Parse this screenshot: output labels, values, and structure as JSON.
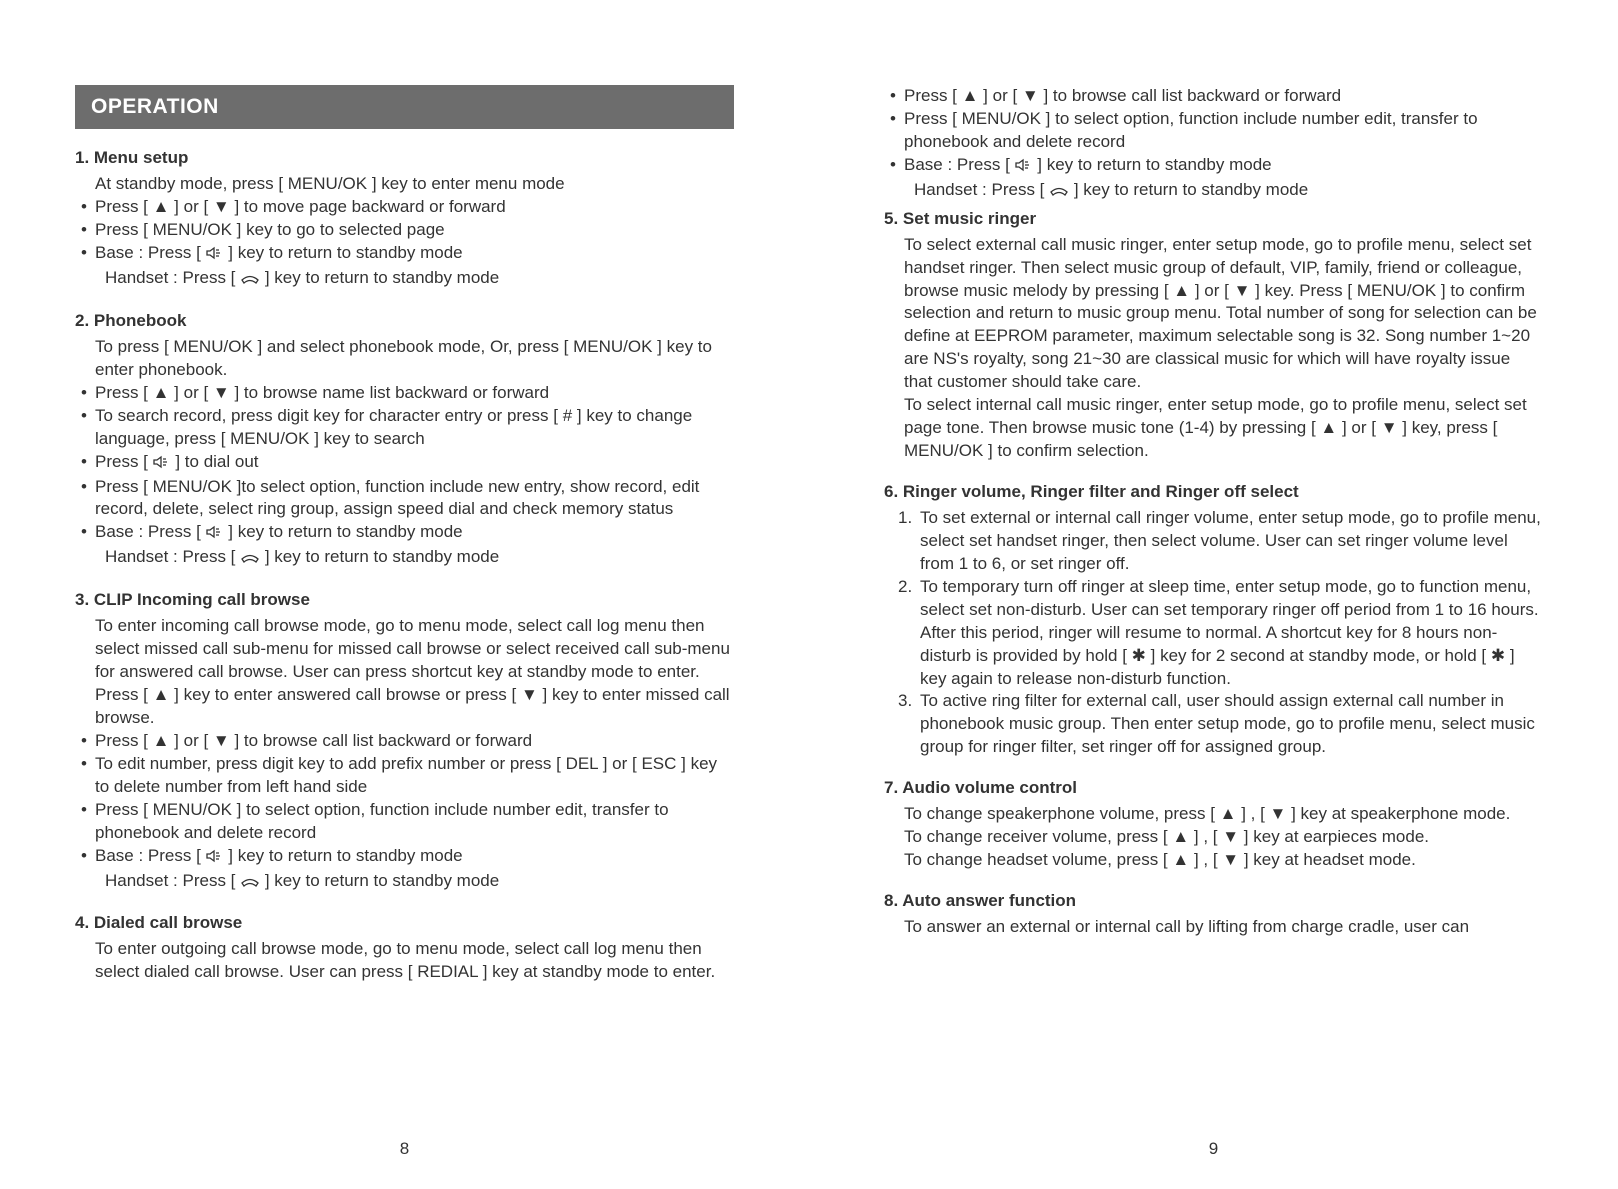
{
  "header": "OPERATION",
  "pageNumbers": {
    "left": "8",
    "right": "9"
  },
  "icons": {
    "up": "▲",
    "down": "▼",
    "hash": "#",
    "star": "✱"
  },
  "left": {
    "s1": {
      "title": "1. Menu setup",
      "intro": "At standby mode, press [ MENU/OK ] key to enter menu mode",
      "b1a": "Press [ ",
      "b1b": " ] or [ ",
      "b1c": " ] to move page backward or forward",
      "b2": "Press [ MENU/OK ] key to go to selected page",
      "b3a": "Base : Press [ ",
      "b3b": " ] key to return to standby mode",
      "b3c": "Handset : Press [ ",
      "b3d": " ] key to return to standby mode"
    },
    "s2": {
      "title": "2. Phonebook",
      "intro": "To press [ MENU/OK ] and select phonebook mode, Or, press [ MENU/OK ] key to enter phonebook.",
      "b1a": "Press [ ",
      "b1b": " ] or [ ",
      "b1c": " ] to browse name list backward or forward",
      "b2a": "To search record, press digit key for character entry or press [ ",
      "b2b": " ] key to change language, press [ MENU/OK ] key to search",
      "b3a": "Press [ ",
      "b3b": " ] to dial out",
      "b4": "Press [ MENU/OK ]to select option, function include new entry, show record, edit record, delete, select ring group, assign speed dial and check memory status",
      "b5a": "Base : Press [ ",
      "b5b": " ] key to return to standby mode",
      "b5c": "Handset : Press [ ",
      "b5d": " ] key to return to standby mode"
    },
    "s3": {
      "title": "3. CLIP Incoming call browse",
      "intro_a": "To enter incoming call browse mode, go to menu mode, select call log menu then select missed call sub-menu for missed call browse or select received call sub-menu for answered call browse. User can press shortcut key at standby mode to enter. Press [ ",
      "intro_b": " ] key to enter answered call browse or press [ ",
      "intro_c": " ] key to enter missed call browse.",
      "b1a": "Press [ ",
      "b1b": " ] or [ ",
      "b1c": " ] to browse call list backward or forward",
      "b2": "To edit number, press digit key to add prefix number or press [ DEL ] or [ ESC ] key to delete number from left hand side",
      "b3": "Press [ MENU/OK ] to select option, function include number edit, transfer to phonebook and delete record",
      "b4a": "Base : Press [ ",
      "b4b": " ] key to return to standby mode",
      "b4c": "Handset : Press [ ",
      "b4d": " ] key to return to standby mode"
    },
    "s4": {
      "title": "4. Dialed call browse",
      "intro": "To enter outgoing call browse mode, go to menu mode, select call log menu then select dialed call browse. User can press [ REDIAL ] key at standby mode to enter."
    }
  },
  "right": {
    "top": {
      "b1a": "Press [ ",
      "b1b": " ] or [ ",
      "b1c": " ] to browse call list backward or forward",
      "b2": "Press [ MENU/OK ] to select option, function include number edit, transfer to phonebook and delete record",
      "b3a": "Base : Press [ ",
      "b3b": " ] key to return to standby mode",
      "b3c": "Handset : Press [ ",
      "b3d": " ] key to return to standby mode"
    },
    "s5": {
      "title": "5. Set music ringer",
      "p1a": "To select external call music ringer, enter setup mode, go to profile menu, select set handset ringer. Then select music group of default, VIP, family, friend or colleague, browse music melody by pressing [ ",
      "p1b": " ] or [ ",
      "p1c": " ] key. Press [ MENU/OK ] to confirm selection and return to music group menu. Total number of song for selection can be define at EEPROM parameter, maximum selectable song is 32. Song number 1~20 are NS's royalty, song 21~30 are classical music for which will have royalty issue that customer should take care.",
      "p2a": "To select internal call music ringer, enter setup mode, go to profile menu, select set page tone. Then browse music tone (1-4) by pressing [ ",
      "p2b": " ] or [ ",
      "p2c": " ] key, press [ MENU/OK ] to confirm selection."
    },
    "s6": {
      "title": "6. Ringer volume, Ringer filter and Ringer off select",
      "n1": "To set external or internal call ringer volume, enter setup mode, go to profile menu, select set handset ringer, then select volume. User can set ringer volume level from 1 to 6, or set ringer off.",
      "n2a": "To temporary turn off ringer at sleep time, enter setup mode, go to function menu, select set non-disturb. User can set temporary ringer off period from 1 to 16 hours. After this period, ringer will resume to normal. A shortcut key for 8 hours non-disturb is provided by hold [ ",
      "n2b": " ] key for 2 second at standby mode, or hold [ ",
      "n2c": " ] key again to release non-disturb function.",
      "n3": "To active ring filter for external call, user should assign external call number in phonebook music group. Then enter setup mode, go to profile menu, select music group for ringer filter, set ringer off for assigned group."
    },
    "s7": {
      "title": "7. Audio volume control",
      "p1a": "To change speakerphone volume, press [ ",
      "p1b": " ] , [ ",
      "p1c": " ] key at speakerphone mode.",
      "p2a": "To change receiver volume, press [ ",
      "p2b": " ] , [ ",
      "p2c": " ] key at earpieces mode.",
      "p3a": "To change headset volume, press [ ",
      "p3b": " ] , [ ",
      "p3c": " ] key at headset mode."
    },
    "s8": {
      "title": "8. Auto answer function",
      "p1": "To answer an external or internal call by lifting from charge cradle, user can"
    }
  }
}
